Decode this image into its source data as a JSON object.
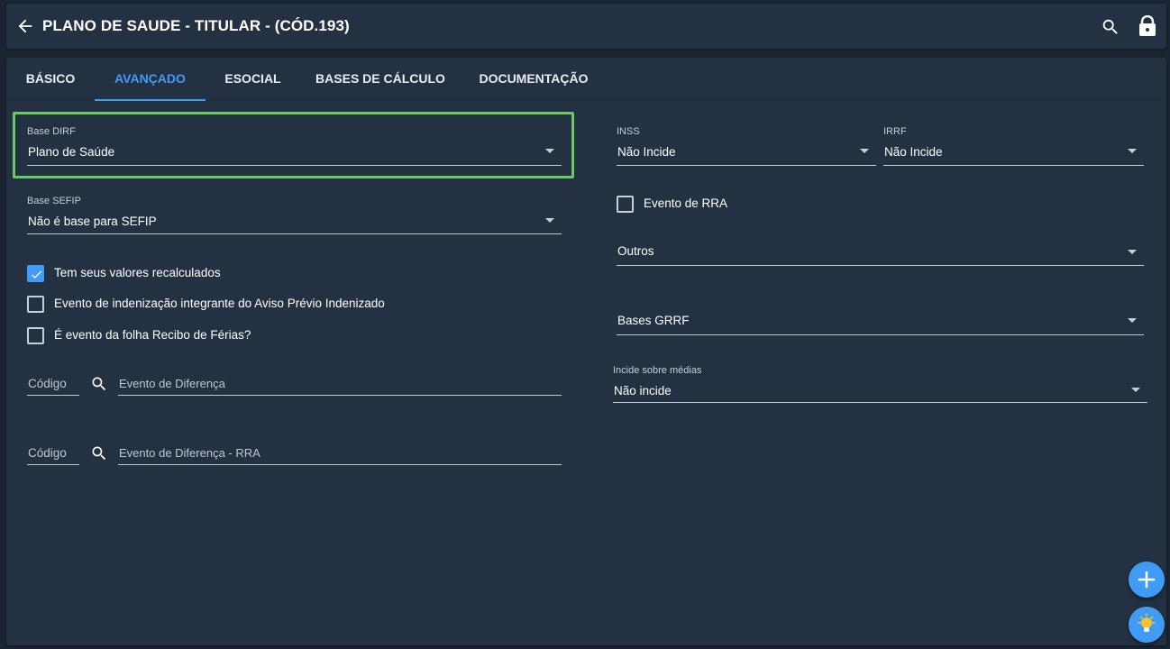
{
  "header": {
    "title": "PLANO DE SAUDE - TITULAR - (CÓD.193)"
  },
  "tabs": [
    {
      "label": "BÁSICO"
    },
    {
      "label": "AVANÇADO"
    },
    {
      "label": "ESOCIAL"
    },
    {
      "label": "BASES DE CÁLCULO"
    },
    {
      "label": "DOCUMENTAÇÃO"
    }
  ],
  "active_tab": "AVANÇADO",
  "left": {
    "base_dirf": {
      "label": "Base DIRF",
      "value": "Plano de Saúde"
    },
    "base_sefip": {
      "label": "Base SEFIP",
      "value": "Não é base para SEFIP"
    },
    "checkboxes": [
      {
        "label": "Tem seus valores recalculados",
        "checked": true
      },
      {
        "label": "Evento de indenização integrante do Aviso Prévio Indenizado",
        "checked": false
      },
      {
        "label": "É evento da folha Recibo de Férias?",
        "checked": false
      }
    ],
    "lookup_diferenca": {
      "code_placeholder": "Código",
      "desc_placeholder": "Evento de Diferença"
    },
    "lookup_diferenca_rra": {
      "code_placeholder": "Código",
      "desc_placeholder": "Evento de Diferença - RRA"
    }
  },
  "right": {
    "inss": {
      "label": "INSS",
      "value": "Não Incide"
    },
    "irrf": {
      "label": "IRRF",
      "value": "Não Incide"
    },
    "evento_rra": {
      "label": "Evento de RRA",
      "checked": false
    },
    "outros": {
      "value": "Outros"
    },
    "bases_grrf": {
      "value": "Bases GRRF"
    },
    "incide_medias": {
      "label": "Incide sobre médias",
      "value": "Não incide"
    }
  },
  "colors": {
    "accent": "#3f9bf3",
    "highlight_border": "#6bc964",
    "background": "#1b2532",
    "surface": "#243142"
  }
}
